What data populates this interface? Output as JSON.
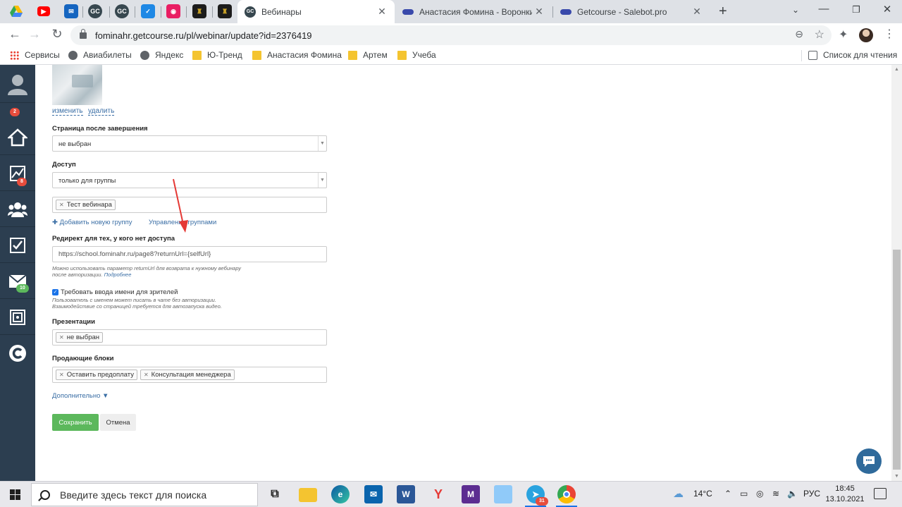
{
  "browser": {
    "tabs": [
      {
        "title": "Вебинары",
        "active": true
      },
      {
        "title": "Анастасия Фомина - Воронки",
        "active": false
      },
      {
        "title": "Getcourse - Salebot.pro",
        "active": false
      }
    ],
    "pinned_icons": [
      "google-drive",
      "youtube",
      "mail",
      "getcourse",
      "getcourse",
      "vk-check",
      "instagram",
      "bookmark-gold",
      "bookmark-gold"
    ],
    "url": "fominahr.getcourse.ru/pl/webinar/update?id=2376419",
    "bookmarks": [
      {
        "label": "Сервисы",
        "icon": "apps-grid-icon"
      },
      {
        "label": "Авиабилеты",
        "icon": "globe-icon"
      },
      {
        "label": "Яндекс",
        "icon": "globe-icon"
      },
      {
        "label": "Ю-Тренд",
        "icon": "folder-icon"
      },
      {
        "label": "Анастасия Фомина",
        "icon": "folder-icon"
      },
      {
        "label": "Артем",
        "icon": "folder-icon"
      },
      {
        "label": "Учеба",
        "icon": "folder-icon"
      }
    ],
    "reading_list": "Список для чтения"
  },
  "sidebar": {
    "badges": {
      "notifications": "2",
      "analytics": "8",
      "messages": "10"
    },
    "items": [
      "profile",
      "home",
      "analytics",
      "users",
      "tasks",
      "messages",
      "safe",
      "getcourse"
    ]
  },
  "form": {
    "image_links": {
      "change": "изменить",
      "delete": "удалить"
    },
    "after_page": {
      "label": "Страница после завершения",
      "value": "не выбран"
    },
    "access": {
      "label": "Доступ",
      "value": "только для группы",
      "groups": [
        "Тест вебинара"
      ]
    },
    "group_links": {
      "add": "Добавить новую группу",
      "manage": "Управление группами"
    },
    "redirect": {
      "label": "Редирект для тех, у кого нет доступа",
      "value": "https://school.fominahr.ru/page8?returnUrl={selfUrl}",
      "hint_line1": "Можно использовать параметр returnUrl для возврата к нужному вебинару",
      "hint_line2": "после авторизации.",
      "hint_link": "Подробнее"
    },
    "require_name": {
      "checked": true,
      "label": "Требовать ввода имени для зрителей",
      "hint_line1": "Пользователь с именем может писать в чате без авторизации.",
      "hint_line2": "Взаимодействие со страницей требуется для автозапуска видео."
    },
    "presentations": {
      "label": "Презентации",
      "tags": [
        "не выбран"
      ]
    },
    "sales_blocks": {
      "label": "Продающие блоки",
      "tags": [
        "Оставить предоплату",
        "Консультация менеджера"
      ]
    },
    "more": "Дополнительно",
    "save": "Сохранить",
    "cancel": "Отмена"
  },
  "taskbar": {
    "search_placeholder": "Введите здесь текст для поиска",
    "weather": "14°C",
    "language": "РУС",
    "time": "18:45",
    "date": "13.10.2021",
    "telegram_badge": "31"
  },
  "colors": {
    "sidebar": "#2c3e50",
    "save_button": "#5cb85c",
    "link": "#3a6ea5",
    "arrow_annotation": "#e53935"
  }
}
